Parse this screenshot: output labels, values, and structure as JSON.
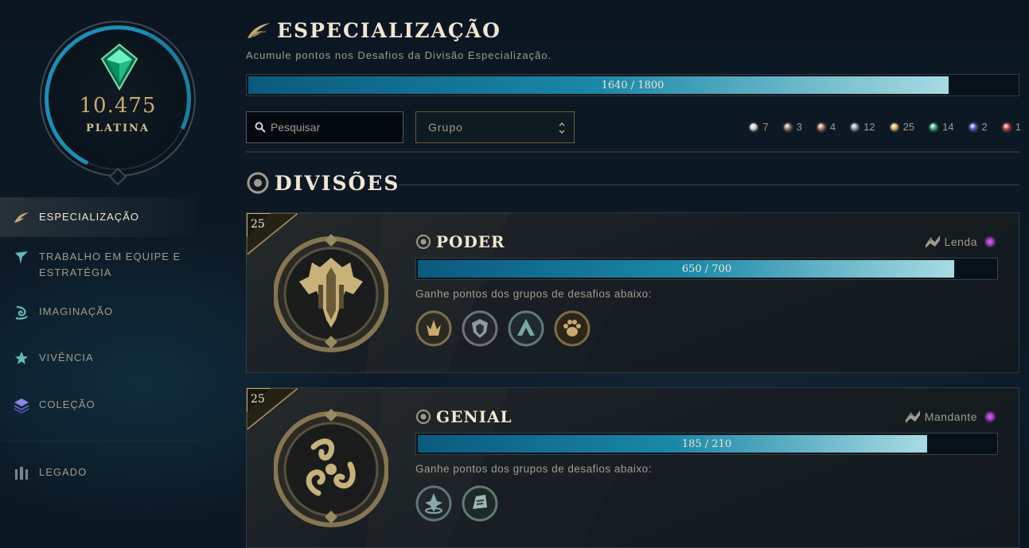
{
  "player": {
    "points": "10.475",
    "rank": "PLATINA"
  },
  "sidebar": {
    "items": [
      {
        "label": "ESPECIALIZAÇÃO",
        "icon": "wing-icon",
        "active": true
      },
      {
        "label": "TRABALHO EM EQUIPE E ESTRATÉGIA",
        "icon": "flag-icon",
        "active": false
      },
      {
        "label": "IMAGINAÇÃO",
        "icon": "swirl-icon",
        "active": false
      },
      {
        "label": "VIVÊNCIA",
        "icon": "star-icon",
        "active": false
      },
      {
        "label": "COLEÇÃO",
        "icon": "layers-icon",
        "active": false
      },
      {
        "label": "LEGADO",
        "icon": "pillars-icon",
        "active": false
      }
    ]
  },
  "header": {
    "title": "ESPECIALIZAÇÃO",
    "subtitle": "Acumule pontos nos Desafios da Divisão Especialização.",
    "progress_text": "1640 / 1800",
    "progress_fraction": 0.911
  },
  "filters": {
    "search_placeholder": "Pesquisar",
    "group_label": "Grupo"
  },
  "tier_counts": [
    {
      "count": "7",
      "color": "#c9c9c9"
    },
    {
      "count": "3",
      "color": "#8c7a6e"
    },
    {
      "count": "4",
      "color": "#b5735a"
    },
    {
      "count": "12",
      "color": "#8a96a3"
    },
    {
      "count": "25",
      "color": "#d8a35a"
    },
    {
      "count": "14",
      "color": "#2fb07a"
    },
    {
      "count": "2",
      "color": "#4a5ad8"
    },
    {
      "count": "1",
      "color": "#d83a3a"
    }
  ],
  "section": {
    "title": "DIVISÕES"
  },
  "categories": [
    {
      "level": "25",
      "name": "PODER",
      "rank_label": "Lenda",
      "progress_text": "650 / 700",
      "progress_fraction": 0.929,
      "hint": "Ganhe pontos dos grupos de desafios abaixo:",
      "groups": [
        "crown-icon",
        "shield-icon",
        "peak-icon",
        "paw-icon"
      ]
    },
    {
      "level": "25",
      "name": "GENIAL",
      "rank_label": "Mandante",
      "progress_text": "185 / 210",
      "progress_fraction": 0.881,
      "hint": "Ganhe pontos dos grupos de desafios abaixo:",
      "groups": [
        "beacon-icon",
        "scroll-icon"
      ]
    }
  ],
  "colors": {
    "gold": "#c8aa6e",
    "text": "#a09b8c",
    "bright": "#f0e6d2",
    "accent": "#1b8fb5"
  }
}
